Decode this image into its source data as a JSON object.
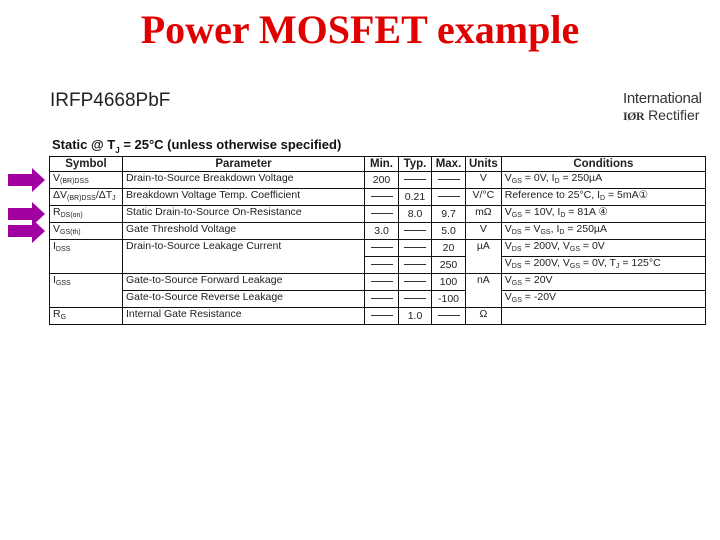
{
  "slide": {
    "title": "Power MOSFET example"
  },
  "datasheet": {
    "part_number": "IRFP4668PbF",
    "logo": {
      "line1": "International",
      "ior": "IØR",
      "line2": "Rectifier"
    },
    "caption": {
      "prefix": "Static @ T",
      "sub": "J",
      "suffix": " = 25°C (unless otherwise specified)"
    },
    "highlight_color": "#a000a0",
    "title_color": "#e00000",
    "headers": [
      "Symbol",
      "Parameter",
      "Min.",
      "Typ.",
      "Max.",
      "Units",
      "Conditions"
    ],
    "rows": [
      {
        "sym": "V",
        "sym_sub": "(BR)DSS",
        "sym_rest": "",
        "param": "Drain-to-Source Breakdown Voltage",
        "min": "200",
        "typ": "—",
        "max": "—",
        "units": "V",
        "cond": "V_GS = 0V, I_D = 250µA",
        "highlight": true
      },
      {
        "sym": "ΔV",
        "sym_sub": "(BR)DSS",
        "sym_rest": "/ΔT_J",
        "param": "Breakdown Voltage Temp. Coefficient",
        "min": "—",
        "typ": "0.21",
        "max": "—",
        "units": "V/°C",
        "cond": "Reference to 25°C, I_D = 5mA①",
        "highlight": false
      },
      {
        "sym": "R",
        "sym_sub": "DS(on)",
        "sym_rest": "",
        "param": "Static Drain-to-Source On-Resistance",
        "min": "—",
        "typ": "8.0",
        "max": "9.7",
        "units": "mΩ",
        "cond": "V_GS = 10V, I_D = 81A ④",
        "highlight": true
      },
      {
        "sym": "V",
        "sym_sub": "GS(th)",
        "sym_rest": "",
        "param": "Gate Threshold Voltage",
        "min": "3.0",
        "typ": "—",
        "max": "5.0",
        "units": "V",
        "cond": "V_DS = V_GS, I_D = 250µA",
        "highlight": true
      },
      {
        "sym": "I",
        "sym_sub": "DSS",
        "sym_rest": "",
        "param": "Drain-to-Source Leakage Current",
        "min": "—",
        "typ": "—",
        "max": "20",
        "units": "µA",
        "cond": "V_DS = 200V, V_GS = 0V",
        "highlight": false
      },
      {
        "sym": "",
        "sym_sub": "",
        "sym_rest": "",
        "param": "",
        "min": "—",
        "typ": "—",
        "max": "250",
        "units": "",
        "cond": "V_DS = 200V, V_GS = 0V, T_J = 125°C",
        "highlight": false
      },
      {
        "sym": "I",
        "sym_sub": "GSS",
        "sym_rest": "",
        "param": "Gate-to-Source Forward Leakage",
        "min": "—",
        "typ": "—",
        "max": "100",
        "units": "nA",
        "cond": "V_GS = 20V",
        "highlight": false
      },
      {
        "sym": "",
        "sym_sub": "",
        "sym_rest": "",
        "param": "Gate-to-Source Reverse Leakage",
        "min": "—",
        "typ": "—",
        "max": "-100",
        "units": "",
        "cond": "V_GS = -20V",
        "highlight": false
      },
      {
        "sym": "R",
        "sym_sub": "G",
        "sym_rest": "",
        "param": "Internal Gate Resistance",
        "min": "—",
        "typ": "1.0",
        "max": "—",
        "units": "Ω",
        "cond": "",
        "highlight": false
      }
    ]
  }
}
